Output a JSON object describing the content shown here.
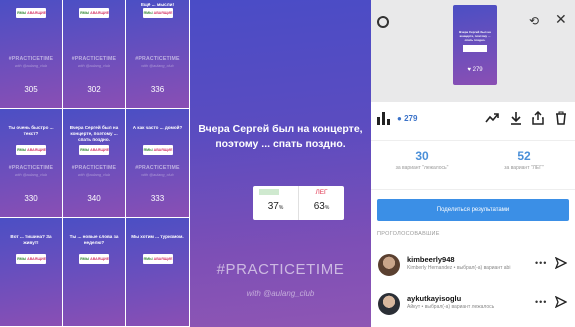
{
  "grid": {
    "tiles": [
      {
        "question": "",
        "poll_yes": "ЯМЫ",
        "poll_no": "АВАЯЩИЕ",
        "tag": "#PRACTICETIME",
        "handle": "with @aulang_club",
        "views": "305"
      },
      {
        "question": "",
        "poll_yes": "ЯМЫ",
        "poll_no": "АВАЯЩИЕ",
        "tag": "#PRACTICETIME",
        "handle": "with @aulang_club",
        "views": "302"
      },
      {
        "question": "Ещё ... мысли!",
        "poll_yes": "ЯМЫ",
        "poll_no": "АВАЯЩИЕ",
        "tag": "#PRACTICETIME",
        "handle": "with @aulang_club",
        "views": "336"
      },
      {
        "question": "Ты очень быстро ... текст?",
        "poll_yes": "ЯМЫ",
        "poll_no": "АВАЯЩИЕ",
        "tag": "#PRACTICETIME",
        "handle": "with @aulang_club",
        "views": "330"
      },
      {
        "question": "Вчера Сергей был на концерте, поэтому ... спать поздно.",
        "poll_yes": "ЯМЫ",
        "poll_no": "АВАЯЩИЕ",
        "tag": "#PRACTICETIME",
        "handle": "with @aulang_club",
        "views": "340"
      },
      {
        "question": "А как часто ... домой?",
        "poll_yes": "ЯМЫ",
        "poll_no": "АВАЯЩИЕ",
        "tag": "#PRACTICETIME",
        "handle": "with @aulang_club",
        "views": "333"
      },
      {
        "question": "Вот ... тишина? За живут!",
        "poll_yes": "ЯМЫ",
        "poll_no": "АВАЯЩИЕ",
        "tag": "",
        "handle": "",
        "views": ""
      },
      {
        "question": "Ты ... новые слова за неделю?",
        "poll_yes": "ЯМЫ",
        "poll_no": "АВАЯЩИЕ",
        "tag": "",
        "handle": "",
        "views": ""
      },
      {
        "question": "Мы хотим ... туризмом.",
        "poll_yes": "ЯМЫ",
        "poll_no": "АВАЯЩИЕ",
        "tag": "",
        "handle": "",
        "views": ""
      }
    ]
  },
  "story": {
    "question": "Вчера Сергей был на концерте, поэтому ... спать поздно.",
    "poll": {
      "option_yes": "",
      "option_no": "ЛЕГ",
      "yes_pct": "37",
      "no_pct": "63",
      "pct_unit": "%"
    },
    "hashtag": "#PRACTICETIME",
    "with_handle": "with @aulang_club"
  },
  "panel": {
    "thumb": {
      "question": "Вчера Сергей был на концерте, поэтому ... спать поздно.",
      "count": "♥ 279"
    },
    "view_count": "279",
    "stats": [
      {
        "value": "30",
        "label": "за вариант \"лежалось\""
      },
      {
        "value": "52",
        "label": "за вариант \"ЛЕГ\""
      }
    ],
    "share_label": "Поделиться результатами",
    "section_title": "ПРОГОЛОСОВАВШИЕ",
    "voters": [
      {
        "name": "kimbeerly948",
        "subtitle": "Kimberly Hernandez • выбрал(-а) вариант abi"
      },
      {
        "name": "aykutkayisoglu",
        "subtitle": "Aйкут • выбрал(-а) вариант лежалось"
      }
    ],
    "colors": {
      "accent": "#3b8fe6",
      "stat_number": "#4a8fd8"
    }
  }
}
